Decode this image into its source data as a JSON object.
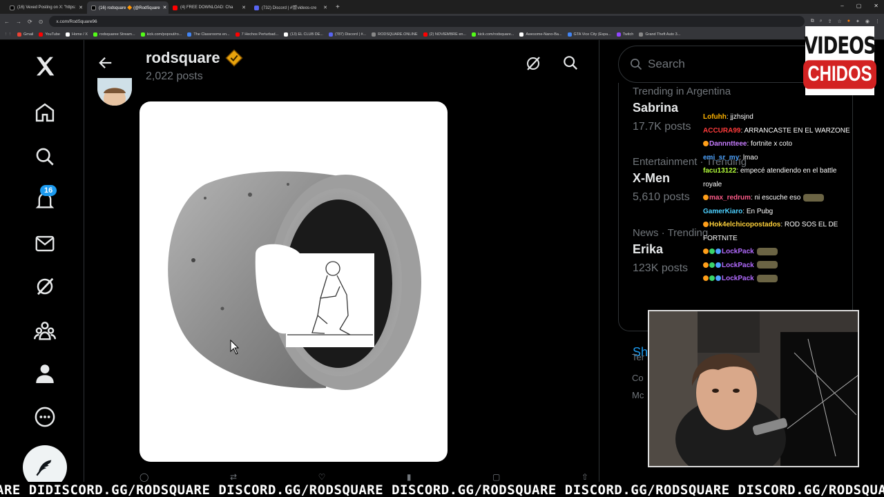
{
  "browser": {
    "tabs": [
      {
        "title": "(16) Vexed Posting on X: \"https:",
        "color": "#000000",
        "active": false
      },
      {
        "title": "(16) rodsquare 🔶 (@RodSquare",
        "color": "#000000",
        "active": true
      },
      {
        "title": "(4) FREE DOWNLOAD: Cha",
        "color": "#ff0000",
        "active": false
      },
      {
        "title": "(732) Discord | #🎬videos-cre",
        "color": "#5865f2",
        "active": false
      }
    ],
    "url": "x.com/RodSquare96",
    "bookmarks": [
      {
        "label": "Gmail",
        "color": "#ea4335"
      },
      {
        "label": "YouTube",
        "color": "#ff0000"
      },
      {
        "label": "Home / X",
        "color": "#ffffff"
      },
      {
        "label": "rodsquaree Stream...",
        "color": "#53fc18"
      },
      {
        "label": "kick.com/popout/ro...",
        "color": "#53fc18"
      },
      {
        "label": "The Classrooms en...",
        "color": "#4285f4"
      },
      {
        "label": "7 Hechos Perturbad...",
        "color": "#ff0000"
      },
      {
        "label": "(13) EL CLUB DE...",
        "color": "#ffffff"
      },
      {
        "label": "(787) Discord | #...",
        "color": "#5865f2"
      },
      {
        "label": "RODSQUARE.ONLINE",
        "color": "#888888"
      },
      {
        "label": "(2) NOVIEMBRE en...",
        "color": "#ff0000"
      },
      {
        "label": "kick.com/rodsquare...",
        "color": "#53fc18"
      },
      {
        "label": "Awesome-Nano-Ba...",
        "color": "#ffffff"
      },
      {
        "label": "GTA Vice City (Espa...",
        "color": "#4285f4"
      },
      {
        "label": "Twitch",
        "color": "#9146ff"
      },
      {
        "label": "Grand Theft Auto 3...",
        "color": "#888888"
      }
    ]
  },
  "nav": {
    "notifications_badge": "16"
  },
  "profile": {
    "name": "rodsquare",
    "posts_count": "2,022 posts"
  },
  "search": {
    "placeholder": "Search"
  },
  "trends": [
    {
      "category": "Trending in Argentina",
      "name": "Sabrina",
      "posts": "17.7K posts"
    },
    {
      "category": "Entertainment · Trending",
      "name": "X-Men",
      "posts": "5,610 posts"
    },
    {
      "category": "News · Trending",
      "name": "Erika",
      "posts": "123K posts"
    }
  ],
  "trends_show_more": "Sh",
  "footer_fragments": [
    "Ter",
    "Co",
    "Mc"
  ],
  "overlay_logo": {
    "line1": "VIDEOS",
    "line2": "CHIDOS"
  },
  "chat": [
    {
      "user": "Lofuhh",
      "color": "#ffb400",
      "msg": "jjzhsjnd"
    },
    {
      "user": "ACCURA99",
      "color": "#ff3b3b",
      "msg": "ARRANCASTE EN EL WARZONE"
    },
    {
      "user": "Dannntteee",
      "color": "#c77dff",
      "msg": "fortnite x coto"
    },
    {
      "user": "emi_sr_my",
      "color": "#4da3ff",
      "msg": "lmao"
    },
    {
      "user": "facu13122",
      "color": "#b4ff3b",
      "msg": "empecé atendiendo en el battle royale"
    },
    {
      "user": "max_redrum",
      "color": "#ff5c8a",
      "msg": "ni escuche eso"
    },
    {
      "user": "GamerKiaro",
      "color": "#4dd0ff",
      "msg": "En Pubg"
    },
    {
      "user": "Hok4elchicopostados",
      "color": "#ffd23b",
      "msg": "ROD SOS EL DE FORTNITE"
    },
    {
      "user": "LockPack",
      "color": "#b36bff",
      "msg": ""
    },
    {
      "user": "LockPack",
      "color": "#b36bff",
      "msg": ""
    },
    {
      "user": "LockPack",
      "color": "#b36bff",
      "msg": ""
    }
  ],
  "ticker": "ARE DIDISCORD.GG/RODSQUARE DISCORD.GG/RODSQUARE DISCORD.GG/RODSQUARE DISCORD.GG/RODSQUARE DISCORD.GG/RODSQUARE DISCORD.GG/RODSQUARE"
}
